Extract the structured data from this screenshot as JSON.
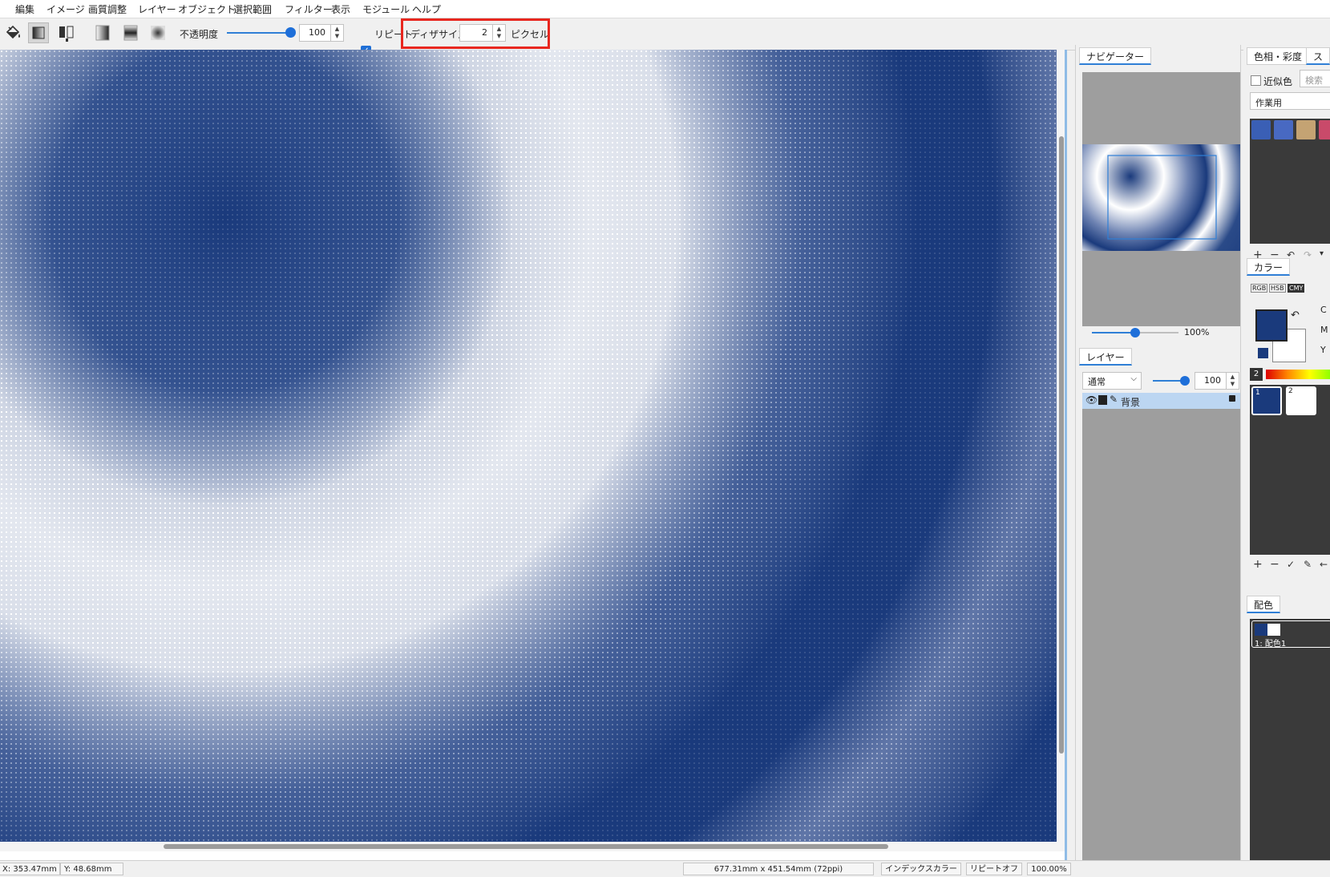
{
  "menu": [
    "編集",
    "イメージ",
    "画質調整",
    "レイヤー",
    "オブジェクト",
    "選択範囲",
    "フィルター",
    "表示",
    "モジュール",
    "ヘルプ"
  ],
  "toolbar": {
    "opacity_label": "不透明度",
    "opacity_value": "100",
    "repeat_label": "リピート",
    "repeat_checked": true,
    "dither_label": "ディザサイズ",
    "dither_value": "2",
    "dither_unit": "ピクセル"
  },
  "navigator": {
    "tab": "ナビゲーター",
    "zoom": "100%"
  },
  "layers": {
    "tab": "レイヤー",
    "blend_mode": "通常",
    "opacity": "100",
    "items": [
      {
        "name": "背景"
      }
    ]
  },
  "right_panel": {
    "tab_hue": "色相・彩度",
    "tab_sw": "ス",
    "similar_label": "近似色",
    "search_placeholder": "検索",
    "palette_name": "作業用",
    "swatches": [
      "#3a5fb5",
      "#4869c2",
      "#c4a373",
      "#c94a6a"
    ],
    "color_tab": "カラー",
    "color_modes": [
      "RGB",
      "HSB",
      "CMY"
    ],
    "cmy_labels": [
      "C",
      "M",
      "Y"
    ],
    "foreground": "#1a3a7c",
    "background": "#ffffff",
    "index_label": "2",
    "slots": [
      "1",
      "2"
    ],
    "scheme_tab": "配色",
    "scheme_item": "1: 配色1"
  },
  "status": {
    "x": "X:  353.47mm",
    "y": "Y:   48.68mm",
    "size": "677.31mm x 451.54mm (72ppi)",
    "mode": "インデックスカラー",
    "repeat": "リピートオフ",
    "zoom": "100.00%"
  },
  "colors": {
    "accent": "#2f7fd6",
    "ink": "#1a3a7c",
    "highlight": "#e8271f"
  }
}
